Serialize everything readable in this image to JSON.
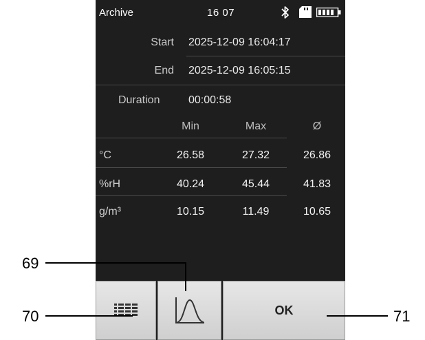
{
  "statusbar": {
    "title": "Archive",
    "time": "16 07",
    "icons": [
      "bluetooth-icon",
      "sd-card-icon",
      "battery-icon"
    ]
  },
  "info": {
    "start_label": "Start",
    "start_value": "2025-12-09 16:04:17",
    "end_label": "End",
    "end_value": "2025-12-09 16:05:15",
    "duration_label": "Duration",
    "duration_value": "00:00:58"
  },
  "table": {
    "headers": [
      "Min",
      "Max",
      "Ø"
    ],
    "rows": [
      {
        "unit": "°C",
        "min": "26.58",
        "max": "27.32",
        "avg": "26.86"
      },
      {
        "unit": "%rH",
        "min": "40.24",
        "max": "45.44",
        "avg": "41.83"
      },
      {
        "unit": "g/m³",
        "min": "10.15",
        "max": "11.49",
        "avg": "10.65"
      }
    ]
  },
  "softkeys": {
    "ok_label": "OK",
    "key1_icon": "list-view-icon",
    "key2_icon": "graph-curve-icon"
  },
  "callouts": {
    "c69": "69",
    "c70": "70",
    "c71": "71"
  },
  "colors": {
    "screen_bg": "#1e1e1e",
    "key_bg": "#dcdcdc"
  }
}
